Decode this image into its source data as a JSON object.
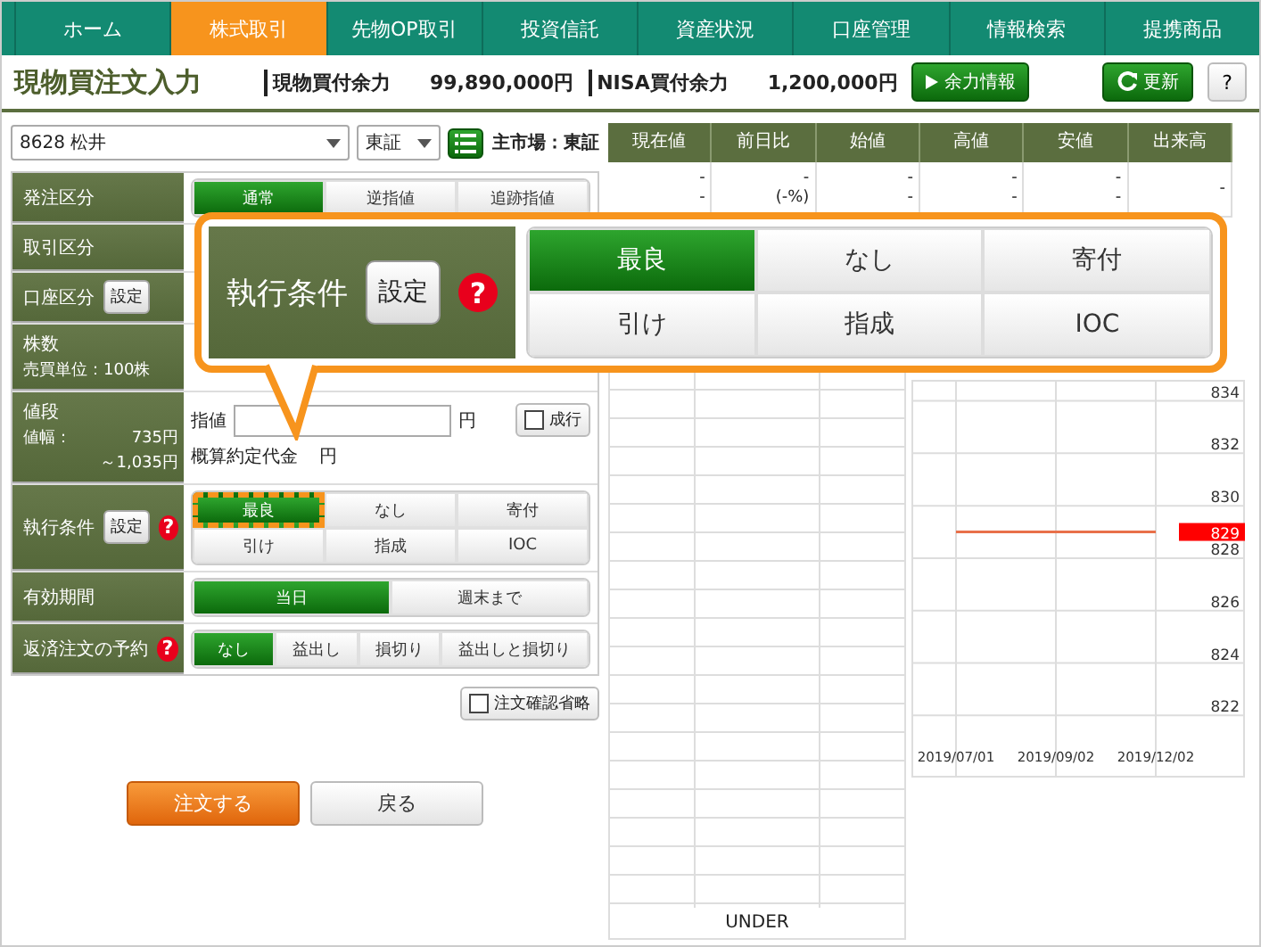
{
  "nav": [
    {
      "label": "ホーム",
      "selected": false
    },
    {
      "label": "株式取引",
      "selected": true
    },
    {
      "label": "先物OP取引",
      "selected": false
    },
    {
      "label": "投資信託",
      "selected": false
    },
    {
      "label": "資産状況",
      "selected": false
    },
    {
      "label": "口座管理",
      "selected": false
    },
    {
      "label": "情報検索",
      "selected": false
    },
    {
      "label": "提携商品",
      "selected": false
    }
  ],
  "header": {
    "title": "現物買注文入力",
    "balances": [
      {
        "label": "現物買付余力",
        "value": "99,890,000円"
      },
      {
        "label": "NISA買付余力",
        "value": "1,200,000円"
      }
    ],
    "info_button": "余力情報",
    "refresh_button": "更新",
    "help_button": "?"
  },
  "stock": {
    "select": "8628 松井",
    "market": "東証",
    "primary_market": "主市場：東証"
  },
  "form": [
    {
      "kind": "options",
      "label": "発注区分",
      "options": [
        {
          "label": "通常",
          "selected": true
        },
        {
          "label": "逆指値",
          "selected": false
        },
        {
          "label": "追跡指値",
          "selected": false
        }
      ]
    },
    {
      "kind": "blank",
      "label": "取引区分"
    },
    {
      "kind": "blank",
      "label": "口座区分",
      "setting_button": "設定"
    },
    {
      "kind": "blank",
      "label": "株数",
      "sub": "売買単位：100株"
    },
    {
      "kind": "price",
      "label": "値段",
      "range_label": "値幅：",
      "range_low": "735円",
      "range_high": "～1,035円",
      "price_label": "指値",
      "unit": "円",
      "market_order": {
        "label": "成行",
        "checked": false
      },
      "estimate_label": "概算約定代金",
      "estimate_unit": "円"
    },
    {
      "kind": "options",
      "label": "執行条件",
      "setting_button": "設定",
      "help": "?",
      "options": [
        {
          "label": "最良",
          "selected": true,
          "highlighted": true
        },
        {
          "label": "なし",
          "selected": false,
          "highlighted": false
        },
        {
          "label": "寄付",
          "selected": false,
          "highlighted": false
        },
        {
          "label": "引け",
          "selected": false,
          "highlighted": false
        },
        {
          "label": "指成",
          "selected": false,
          "highlighted": false
        },
        {
          "label": "IOC",
          "selected": false,
          "highlighted": false
        }
      ]
    },
    {
      "kind": "options",
      "label": "有効期間",
      "options": [
        {
          "label": "当日",
          "selected": true
        },
        {
          "label": "週末まで",
          "selected": false
        }
      ]
    },
    {
      "kind": "options",
      "label": "返済注文の予約",
      "help": "?",
      "options": [
        {
          "label": "なし",
          "selected": true
        },
        {
          "label": "益出し",
          "selected": false
        },
        {
          "label": "損切り",
          "selected": false
        },
        {
          "label": "益出しと損切り",
          "selected": false
        }
      ]
    }
  ],
  "skip_confirm": {
    "label": "注文確認省略",
    "checked": false
  },
  "actions": [
    {
      "label": "注文する",
      "kind": "primary"
    },
    {
      "label": "戻る",
      "kind": "secondary"
    }
  ],
  "quote": {
    "columns": [
      "現在値",
      "前日比",
      "始値",
      "高値",
      "安値",
      "出来高"
    ],
    "row": [
      [
        "-",
        "-"
      ],
      [
        "-",
        "(-%)"
      ],
      [
        "-",
        "-"
      ],
      [
        "-",
        "-"
      ],
      [
        "-",
        "-"
      ],
      [
        "-"
      ]
    ]
  },
  "order_book": {
    "footer": "UNDER"
  },
  "chart": {
    "chart_data": {
      "type": "line",
      "x": [
        "2019/07/01",
        "2019/09/02",
        "2019/12/02"
      ],
      "series": [
        {
          "color": "#e8704a",
          "values": [
            829,
            829,
            829
          ]
        }
      ],
      "ylim": [
        819.7,
        834.8
      ],
      "yticks": [
        822,
        824,
        826,
        828,
        830,
        832,
        834
      ],
      "grid": true
    },
    "price_label": "829"
  },
  "callout": {
    "label": "執行条件",
    "setting_button": "設定",
    "help": "?",
    "options": [
      {
        "label": "最良",
        "selected": true
      },
      {
        "label": "なし",
        "selected": false
      },
      {
        "label": "寄付",
        "selected": false
      },
      {
        "label": "引け",
        "selected": false
      },
      {
        "label": "指成",
        "selected": false
      },
      {
        "label": "IOC",
        "selected": false
      }
    ]
  }
}
